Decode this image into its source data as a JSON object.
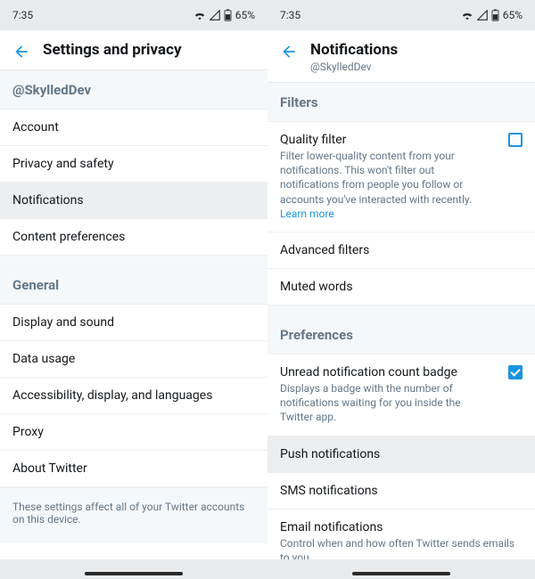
{
  "status": {
    "time": "7:35",
    "battery": "65%"
  },
  "left": {
    "title": "Settings and privacy",
    "user_header": "@SkylledDev",
    "items": [
      "Account",
      "Privacy and safety",
      "Notifications",
      "Content preferences"
    ],
    "active_index": 2,
    "general_header": "General",
    "general_items": [
      "Display and sound",
      "Data usage",
      "Accessibility, display, and languages",
      "Proxy",
      "About Twitter"
    ],
    "footnote": "These settings affect all of your Twitter accounts on this device."
  },
  "right": {
    "title": "Notifications",
    "subtitle": "@SkylledDev",
    "filters_header": "Filters",
    "quality": {
      "label": "Quality filter",
      "desc": "Filter lower-quality content from your notifications. This won't filter out notifications from people you follow or accounts you've interacted with recently. ",
      "link": "Learn more",
      "checked": false
    },
    "advanced": "Advanced filters",
    "muted": "Muted words",
    "prefs_header": "Preferences",
    "badge": {
      "label": "Unread notification count badge",
      "desc": "Displays a badge with the number of notifications waiting for you inside the Twitter app.",
      "checked": true
    },
    "push": "Push notifications",
    "sms": "SMS notifications",
    "email": {
      "label": "Email notifications",
      "desc": "Control when and how often Twitter sends emails to you."
    },
    "active_row": "push"
  }
}
